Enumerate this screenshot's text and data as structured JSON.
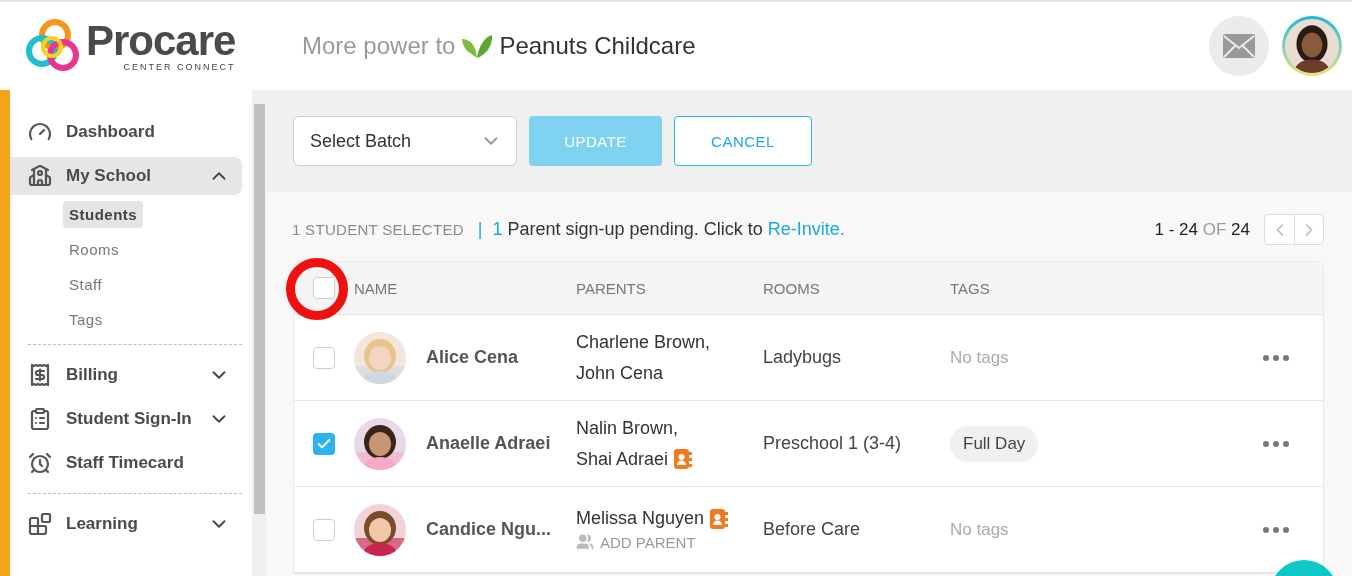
{
  "header": {
    "logo": {
      "name": "Procare",
      "subtitle": "CENTER CONNECT"
    },
    "tagline": "More power to",
    "school": "Peanuts Childcare"
  },
  "sidebar": {
    "groups": [
      [
        {
          "label": "Dashboard",
          "selected": false
        },
        {
          "label": "My School",
          "selected": true,
          "expanded": true,
          "children": [
            {
              "label": "Students",
              "selected": true
            },
            {
              "label": "Rooms",
              "selected": false
            },
            {
              "label": "Staff",
              "selected": false
            },
            {
              "label": "Tags",
              "selected": false
            }
          ]
        }
      ],
      [
        {
          "label": "Billing",
          "selected": false,
          "expanded": false
        },
        {
          "label": "Student Sign-In",
          "selected": false,
          "expanded": false
        },
        {
          "label": "Staff Timecard",
          "selected": false
        }
      ],
      [
        {
          "label": "Learning",
          "selected": false,
          "expanded": false
        }
      ]
    ]
  },
  "toolbar": {
    "select": {
      "placeholder": "Select Batch"
    },
    "buttons": [
      {
        "label": "UPDATE",
        "kind": "primary",
        "disabled": true
      },
      {
        "label": "CANCEL",
        "kind": "outline",
        "disabled": false
      }
    ]
  },
  "status": {
    "selected": "1 STUDENT SELECTED",
    "separator": "|",
    "pending_count": "1",
    "pending_text": "Parent sign-up pending. Click to",
    "link": "Re-Invite.",
    "range": "1 - 24",
    "of": "OF",
    "total": "24"
  },
  "table": {
    "select_all": {
      "checked": false,
      "highlighted": true
    },
    "columns": [
      "NAME",
      "PARENTS",
      "ROOMS",
      "TAGS"
    ],
    "rows": [
      {
        "checked": false,
        "name": "Alice Cena",
        "parents": [
          {
            "name": "Charlene Brown,",
            "app": false
          },
          {
            "name": "John Cena",
            "app": false
          }
        ],
        "room": "Ladybugs",
        "tag": "No tags",
        "tag_empty": true
      },
      {
        "checked": true,
        "name": "Anaelle Adraei",
        "parents": [
          {
            "name": "Nalin Brown,",
            "app": false
          },
          {
            "name": "Shai Adraei",
            "app": true
          }
        ],
        "room": "Preschool 1 (3-4)",
        "tag": "Full Day",
        "tag_empty": false
      },
      {
        "checked": false,
        "name": "Candice Ngu...",
        "parents": [
          {
            "name": "Melissa Nguyen",
            "app": true
          }
        ],
        "add_parent": "ADD PARENT",
        "room": "Before Care",
        "tag": "No tags",
        "tag_empty": true
      }
    ]
  }
}
